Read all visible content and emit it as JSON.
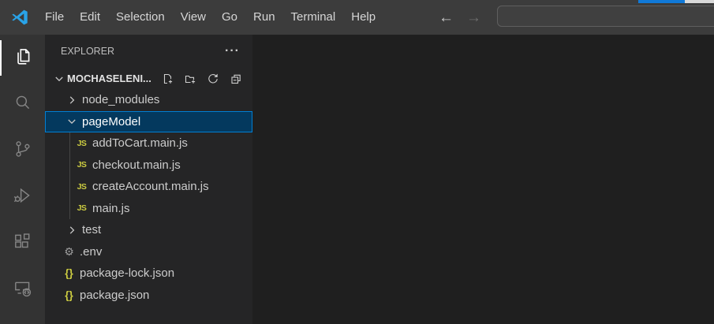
{
  "titlebar": {
    "menus": [
      "File",
      "Edit",
      "Selection",
      "View",
      "Go",
      "Run",
      "Terminal",
      "Help"
    ],
    "back_arrow": "←",
    "forward_arrow": "→",
    "command_center": {
      "value": "",
      "placeholder": ""
    }
  },
  "activity_bar": {
    "items": [
      {
        "name": "explorer",
        "active": true
      },
      {
        "name": "search",
        "active": false
      },
      {
        "name": "source-control",
        "active": false
      },
      {
        "name": "run-and-debug",
        "active": false
      },
      {
        "name": "extensions",
        "active": false
      },
      {
        "name": "remote-explorer",
        "active": false
      }
    ]
  },
  "sidebar": {
    "title": "EXPLORER",
    "more_actions_label": "···",
    "section": {
      "label": "MOCHASELENI...",
      "actions": [
        {
          "name": "new-file"
        },
        {
          "name": "new-folder"
        },
        {
          "name": "refresh"
        },
        {
          "name": "collapse-all"
        }
      ]
    },
    "tree": [
      {
        "type": "folder",
        "label": "node_modules",
        "expanded": false,
        "depth": 0,
        "selected": false
      },
      {
        "type": "folder",
        "label": "pageModel",
        "expanded": true,
        "depth": 0,
        "selected": true
      },
      {
        "type": "file",
        "icon": "js",
        "label": "addToCart.main.js",
        "depth": 1
      },
      {
        "type": "file",
        "icon": "js",
        "label": "checkout.main.js",
        "depth": 1
      },
      {
        "type": "file",
        "icon": "js",
        "label": "createAccount.main.js",
        "depth": 1
      },
      {
        "type": "file",
        "icon": "js",
        "label": "main.js",
        "depth": 1
      },
      {
        "type": "folder",
        "label": "test",
        "expanded": false,
        "depth": 0,
        "selected": false
      },
      {
        "type": "file",
        "icon": "gear",
        "label": ".env",
        "depth": 0
      },
      {
        "type": "file",
        "icon": "json",
        "label": "package-lock.json",
        "depth": 0
      },
      {
        "type": "file",
        "icon": "json",
        "label": "package.json",
        "depth": 0
      }
    ]
  },
  "icons": {
    "js_glyph": "JS",
    "json_glyph": "{}",
    "gear_glyph": "⚙"
  },
  "colors": {
    "selection_bg": "#04395e",
    "selection_border": "#007fd4",
    "js_icon": "#cbcb41",
    "json_icon": "#cbcb41",
    "gear_icon": "#9d9d9d",
    "strip_blue": "#1079d8",
    "strip_gray": "#d9d9d9",
    "logo_blue": "#29a3e8"
  }
}
